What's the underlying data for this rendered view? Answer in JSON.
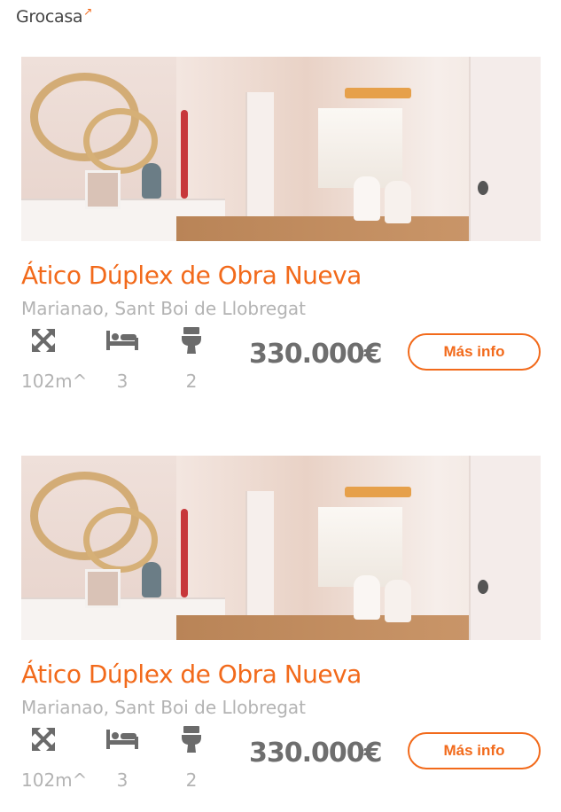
{
  "brand": {
    "logo_text": "Grocasa",
    "logo_mark": "↗"
  },
  "listings": [
    {
      "title": "Ático Dúplex de Obra Nueva",
      "location": "Marianao, Sant Boi de Llobregat",
      "area": "102m^",
      "bedrooms": "3",
      "bathrooms": "2",
      "price": "330.000€",
      "button_label": "Más info"
    },
    {
      "title": "Ático Dúplex de Obra Nueva",
      "location": "Marianao, Sant Boi de Llobregat",
      "area": "102m^",
      "bedrooms": "3",
      "bathrooms": "2",
      "price": "330.000€",
      "button_label": "Más info"
    }
  ],
  "icons": {
    "area": "expand-arrows-icon",
    "bedrooms": "bed-icon",
    "bathrooms": "toilet-icon"
  },
  "colors": {
    "accent": "#f26a1b",
    "muted_text": "#b3b3b3",
    "price_text": "#6e6e6e",
    "icon": "#6b6b6b"
  }
}
